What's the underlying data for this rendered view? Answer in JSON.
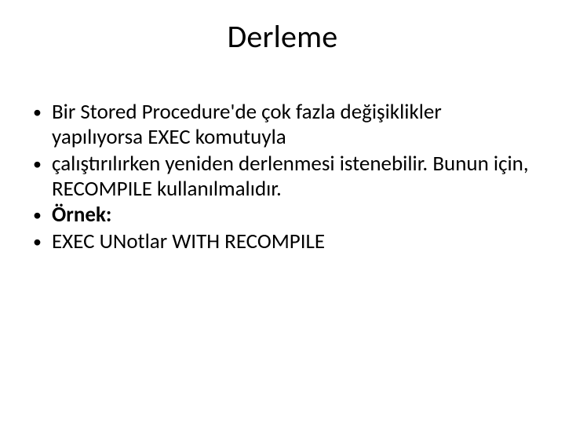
{
  "title": "Derleme",
  "bullets": [
    {
      "text": "Bir Stored Procedure'de çok fazla değişiklikler yapılıyorsa EXEC komutuyla",
      "bold": false
    },
    {
      "text": "çalıştırılırken yeniden derlenmesi istenebilir. Bunun için, RECOMPILE kullanılmalıdır.",
      "bold": false
    },
    {
      "text": "Örnek:",
      "bold": true
    },
    {
      "text": "EXEC UNotlar WITH RECOMPILE",
      "bold": false
    }
  ]
}
